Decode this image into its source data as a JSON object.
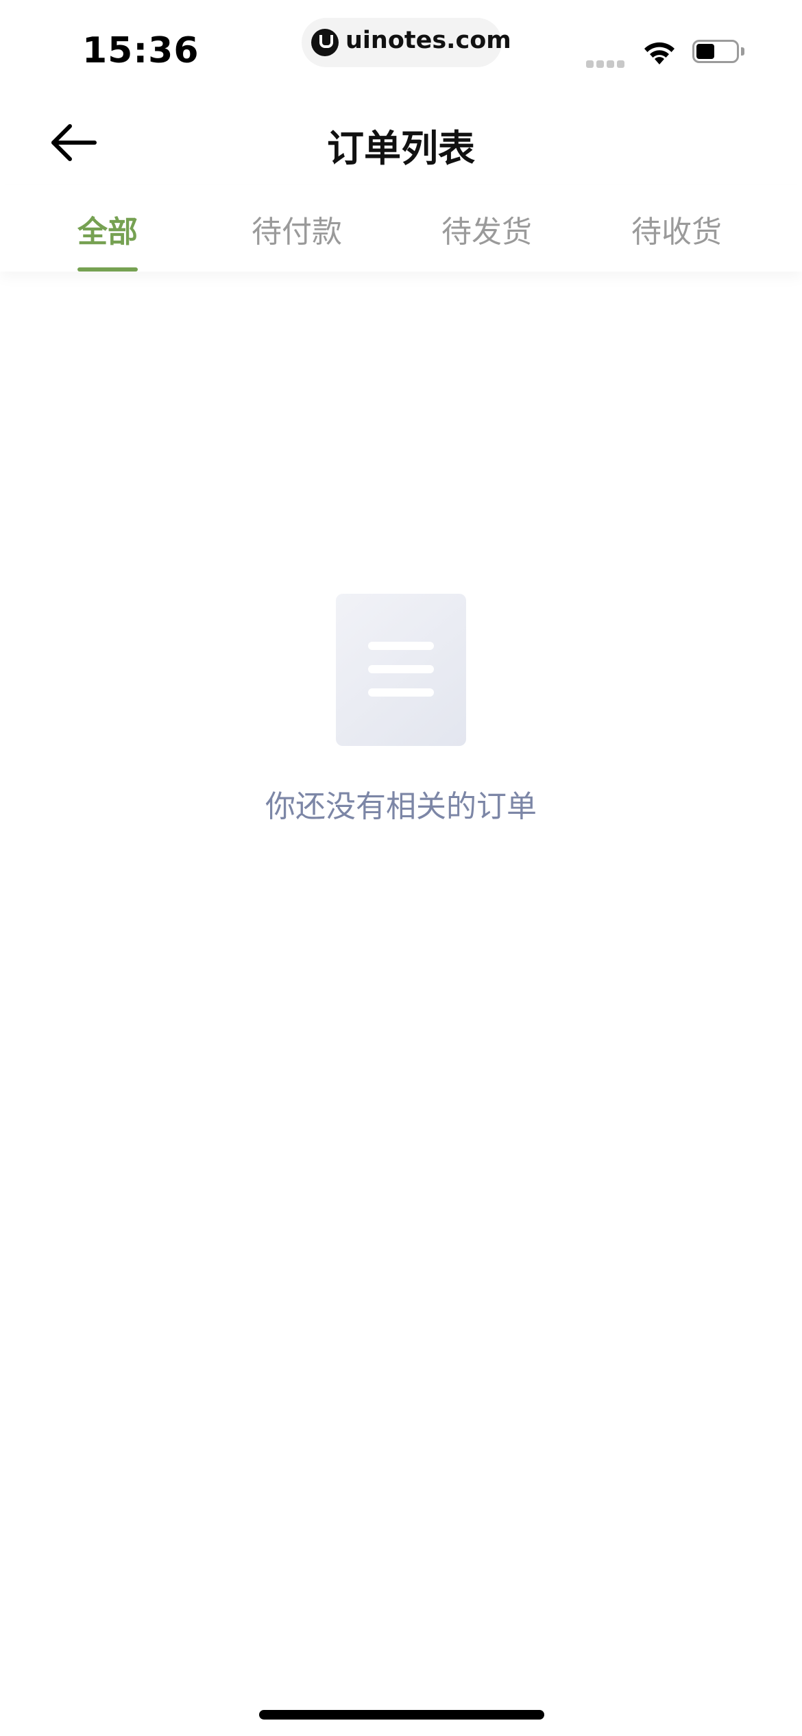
{
  "status_bar": {
    "time": "15:36",
    "url": "uinotes.com"
  },
  "header": {
    "title": "订单列表"
  },
  "tabs": [
    {
      "label": "全部",
      "active": true
    },
    {
      "label": "待付款",
      "active": false
    },
    {
      "label": "待发货",
      "active": false
    },
    {
      "label": "待收货",
      "active": false
    }
  ],
  "empty_state": {
    "message": "你还没有相关的订单"
  },
  "colors": {
    "accent": "#76a152",
    "inactive_tab": "#9a9a9a",
    "empty_text": "#7c86a6"
  },
  "icons": {
    "back": "back-arrow-icon",
    "wifi": "wifi-icon",
    "battery": "battery-icon",
    "signal": "signal-icon",
    "site_logo": "site-logo-icon",
    "empty": "document-icon"
  }
}
